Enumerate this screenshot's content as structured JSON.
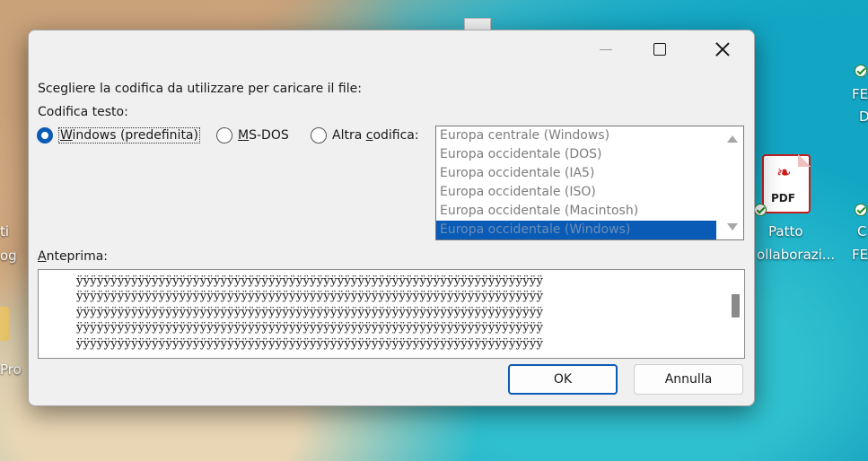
{
  "desktop": {
    "labels": [
      {
        "id": "fe-1",
        "text": "FE"
      },
      {
        "id": "fe-1b",
        "text": "D"
      },
      {
        "id": "left-1",
        "text": "ti"
      },
      {
        "id": "left-2",
        "text": "og"
      },
      {
        "id": "left-3",
        "text": "Pro"
      },
      {
        "id": "pdf-1",
        "text": "Patto"
      },
      {
        "id": "pdf-2",
        "text": "ollaborazi..."
      },
      {
        "id": "right-c",
        "text": "C"
      },
      {
        "id": "right-fe",
        "text": "FE..."
      }
    ],
    "pdf_icon_text": "PDF"
  },
  "dialog": {
    "prompt": "Scegliere la codifica da utilizzare per caricare il file:",
    "group_label": "Codifica testo:",
    "radios": [
      {
        "label": "Windows (predefinita)",
        "accesskey": "W",
        "rest": "indows (predefinita)",
        "checked": true
      },
      {
        "label": "MS-DOS",
        "accesskey": "M",
        "rest": "S-DOS",
        "checked": false
      },
      {
        "label": "Altra codifica:",
        "pre": "Altra ",
        "accesskey": "c",
        "rest": "odifica:",
        "checked": false
      }
    ],
    "encodings": [
      "Europa centrale (Windows)",
      "Europa occidentale (DOS)",
      "Europa occidentale (IA5)",
      "Europa occidentale (ISO)",
      "Europa occidentale (Macintosh)",
      "Europa occidentale (Windows)"
    ],
    "selected_encoding": "Europa occidentale (Windows)",
    "preview_label": "Anteprima:",
    "preview_label_accesskey": "A",
    "preview_label_rest": "nteprima:",
    "preview_lines": [
      "ÿÿÿÿÿÿÿÿÿÿÿÿÿÿÿÿÿÿÿÿÿÿÿÿÿÿÿÿÿÿÿÿÿÿÿÿÿÿÿÿÿÿÿÿÿÿÿÿÿÿÿÿÿÿÿÿÿÿÿÿÿÿÿÿÿÿÿÿ",
      "ÿÿÿÿÿÿÿÿÿÿÿÿÿÿÿÿÿÿÿÿÿÿÿÿÿÿÿÿÿÿÿÿÿÿÿÿÿÿÿÿÿÿÿÿÿÿÿÿÿÿÿÿÿÿÿÿÿÿÿÿÿÿÿÿÿÿÿÿ",
      "ÿÿÿÿÿÿÿÿÿÿÿÿÿÿÿÿÿÿÿÿÿÿÿÿÿÿÿÿÿÿÿÿÿÿÿÿÿÿÿÿÿÿÿÿÿÿÿÿÿÿÿÿÿÿÿÿÿÿÿÿÿÿÿÿÿÿÿÿ",
      "ÿÿÿÿÿÿÿÿÿÿÿÿÿÿÿÿÿÿÿÿÿÿÿÿÿÿÿÿÿÿÿÿÿÿÿÿÿÿÿÿÿÿÿÿÿÿÿÿÿÿÿÿÿÿÿÿÿÿÿÿÿÿÿÿÿÿÿÿ",
      "ÿÿÿÿÿÿÿÿÿÿÿÿÿÿÿÿÿÿÿÿÿÿÿÿÿÿÿÿÿÿÿÿÿÿÿÿÿÿÿÿÿÿÿÿÿÿÿÿÿÿÿÿÿÿÿÿÿÿÿÿÿÿÿÿÿÿÿÿ"
    ],
    "ok_label": "OK",
    "cancel_label": "Annulla"
  },
  "colors": {
    "accent": "#0a5bb5",
    "dialog_bg": "#f0f0f0",
    "pdf_red": "#d01717"
  }
}
